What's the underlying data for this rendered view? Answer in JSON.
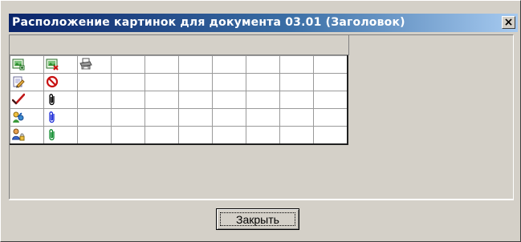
{
  "window": {
    "title": "Расположение картинок для документа 03.01 (Заголовок)",
    "close_glyph": "×"
  },
  "grid": {
    "rows": 5,
    "cols": 10,
    "icons": [
      [
        "image-add-icon",
        "image-delete-icon",
        "printer-icon"
      ],
      [
        "edit-document-icon",
        "forbidden-icon"
      ],
      [
        "checkmark-icon",
        "paperclip-black-icon"
      ],
      [
        "people-swap-icon",
        "paperclip-blue-icon"
      ],
      [
        "user-lock-icon",
        "paperclip-green-icon"
      ]
    ]
  },
  "buttons": {
    "close_label": "Закрыть"
  },
  "colors": {
    "title_gradient_start": "#0a246a",
    "title_gradient_end": "#a6caf0",
    "window_bg": "#d4d0c8"
  }
}
